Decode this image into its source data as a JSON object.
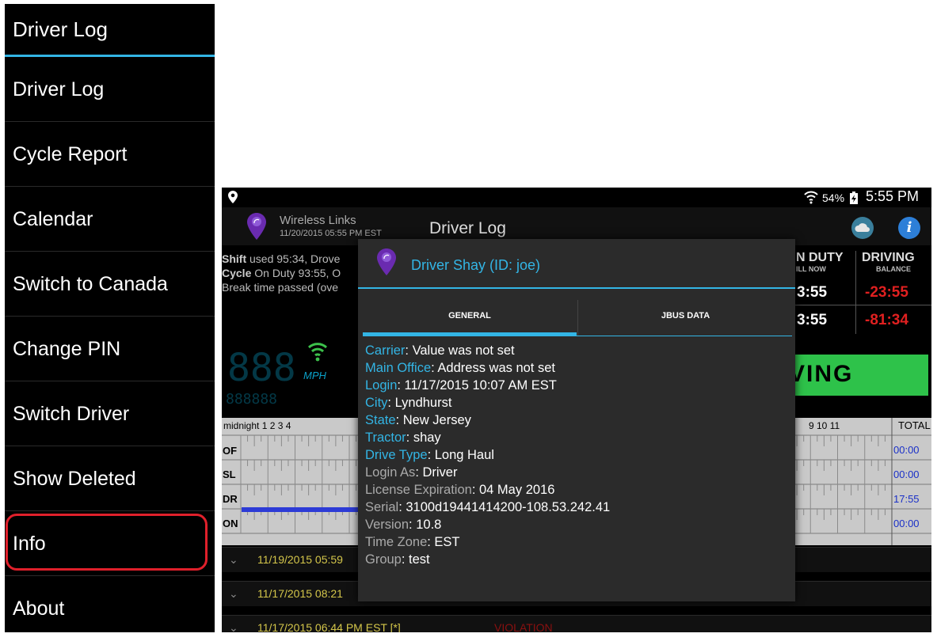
{
  "drawer": {
    "title": "Driver Log",
    "items": [
      {
        "label": "Driver Log"
      },
      {
        "label": "Cycle Report"
      },
      {
        "label": "Calendar"
      },
      {
        "label": "Switch to Canada"
      },
      {
        "label": "Change PIN"
      },
      {
        "label": "Switch Driver"
      },
      {
        "label": "Show Deleted"
      },
      {
        "label": "Info"
      },
      {
        "label": "About"
      }
    ]
  },
  "status_bar": {
    "battery": "54%",
    "time": "5:55 PM"
  },
  "action_bar": {
    "brand": "Wireless Links",
    "brand_date": "11/20/2015 05:55 PM EST",
    "title": "Driver Log"
  },
  "summary": {
    "shift_label": "Shift",
    "shift_text": " used 95:34, Drove",
    "cycle_label": "Cycle",
    "cycle_text": " On Duty 93:55, O",
    "break_text": "Break time passed (ove"
  },
  "stats": {
    "on_duty_head": "N DUTY",
    "on_duty_sub": "ILL NOW",
    "driving_head": "DRIVING",
    "driving_sub": "BALANCE",
    "on_duty_values": [
      "3:55",
      "3:55"
    ],
    "driving_values": [
      "-23:55",
      "-81:34"
    ]
  },
  "gauge": {
    "speed": "888",
    "unit": "MPH",
    "sub": "888888"
  },
  "status_banner": "VING",
  "grid": {
    "hours_left": "midnight  1    2    3    4",
    "hours_right": "9   10   11",
    "total_label": "TOTAL",
    "rows": [
      {
        "code": "OF",
        "total": "00:00"
      },
      {
        "code": "SL",
        "total": "00:00"
      },
      {
        "code": "DR",
        "total": "17:55"
      },
      {
        "code": "ON",
        "total": "00:00"
      }
    ]
  },
  "log_rows": [
    {
      "date": "11/19/2015 05:59",
      "violation": ""
    },
    {
      "date": "11/17/2015 08:21",
      "violation": ""
    },
    {
      "date": "11/17/2015 06:44 PM EST [*]",
      "violation": "VIOLATION"
    }
  ],
  "dialog": {
    "title": "Driver Shay (ID: joe)",
    "tabs": [
      "GENERAL",
      "JBUS DATA"
    ],
    "active_tab": "GENERAL",
    "fields": [
      {
        "label": "Carrier",
        "value": ": Value was not set",
        "label_color": "blue"
      },
      {
        "label": "Main Office",
        "value": ": Address was not set",
        "label_color": "blue"
      },
      {
        "label": "Login",
        "value": ": 11/17/2015 10:07 AM EST",
        "label_color": "blue"
      },
      {
        "label": "City",
        "value": ": Lyndhurst",
        "label_color": "blue"
      },
      {
        "label": "State",
        "value": ": New Jersey",
        "label_color": "blue"
      },
      {
        "label": "Tractor",
        "value": ": shay",
        "label_color": "blue"
      },
      {
        "label": "Drive Type",
        "value": ": Long Haul",
        "label_color": "blue"
      },
      {
        "label": "Login As",
        "value": ": Driver",
        "label_color": "gray"
      },
      {
        "label": "License Expiration",
        "value": ": 04 May 2016",
        "label_color": "gray"
      },
      {
        "label": "Serial",
        "value": ": 3100d19441414200-108.53.242.41",
        "label_color": "gray"
      },
      {
        "label": "Version",
        "value": ": 10.8",
        "label_color": "gray"
      },
      {
        "label": "Time Zone",
        "value": ": EST",
        "label_color": "gray"
      },
      {
        "label": "Group",
        "value": ": test",
        "label_color": "gray"
      }
    ]
  },
  "colors": {
    "accent": "#33b5e5",
    "highlight": "#e0202b",
    "driving_green": "#2ec24a",
    "negative_red": "#e02020"
  },
  "icons": [
    "location-pin-icon",
    "wifi-icon",
    "battery-icon",
    "app-logo-icon",
    "cloud-sync-icon",
    "info-icon"
  ]
}
